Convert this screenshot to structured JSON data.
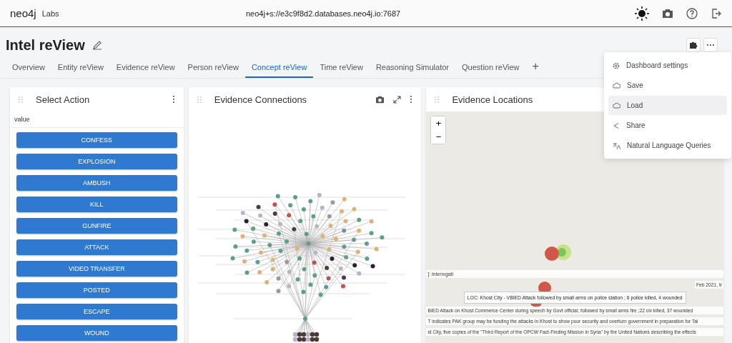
{
  "top_bar": {
    "logo": "neo4j",
    "logo_suffix": "Labs",
    "connection": "neo4j+s://e3c9f8d2.databases.neo4j.io:7687"
  },
  "dashboard": {
    "title": "Intel reView"
  },
  "tabs": [
    {
      "label": "Overview",
      "selected": false
    },
    {
      "label": "Entity reView",
      "selected": false
    },
    {
      "label": "Evidence reView",
      "selected": false
    },
    {
      "label": "Person reView",
      "selected": false
    },
    {
      "label": "Concept reView",
      "selected": true
    },
    {
      "label": "Time reView",
      "selected": false
    },
    {
      "label": "Reasoning Simulator",
      "selected": false
    },
    {
      "label": "Question reView",
      "selected": false
    }
  ],
  "add_tab": "+",
  "menu": [
    {
      "label": "Dashboard settings",
      "kind": "settings",
      "highlighted": false
    },
    {
      "label": "Save",
      "kind": "save",
      "highlighted": false
    },
    {
      "label": "Load",
      "kind": "load",
      "highlighted": true
    },
    {
      "label": "Share",
      "kind": "share",
      "highlighted": false
    },
    {
      "label": "Natural Language Queries",
      "kind": "queries",
      "highlighted": false
    }
  ],
  "select_panel": {
    "title": "Select Action",
    "column": "value",
    "actions": [
      "CONFESS",
      "EXPLOSION",
      "AMBUSH",
      "KILL",
      "GUNFIRE",
      "ATTACK",
      "VIDEO TRANSFER",
      "POSTED",
      "ESCAPE",
      "WOUND"
    ]
  },
  "graph_panel": {
    "title": "Evidence Connections"
  },
  "map_panel": {
    "title": "Evidence Locations",
    "zoom_in": "+",
    "zoom_out": "−",
    "tooltips": [
      {
        "text": "]: Interrogati",
        "kind": "row"
      },
      {
        "text": "Feb 2021, tr",
        "kind": "row_right"
      },
      {
        "text": "LOC: Khost City - VBIED Attack followed by small arms on police station ; 6 police killed, 4 wounded",
        "kind": "popup"
      },
      {
        "text": "BIED Attack on Khost Commerce Center during speech by Govt official; followed by small arms fire ;22 civ killed, 37 wounded",
        "kind": "row"
      },
      {
        "text": "T indicates PAK group may be funding the attacks in Khost to show poor security and overturn government in preparation for Tal",
        "kind": "row"
      },
      {
        "text": "st City, five copies of the \"Third Report of the OPCW Fact-Finding Mission in Syria\" by the United Nations describing the effects",
        "kind": "row"
      }
    ]
  }
}
